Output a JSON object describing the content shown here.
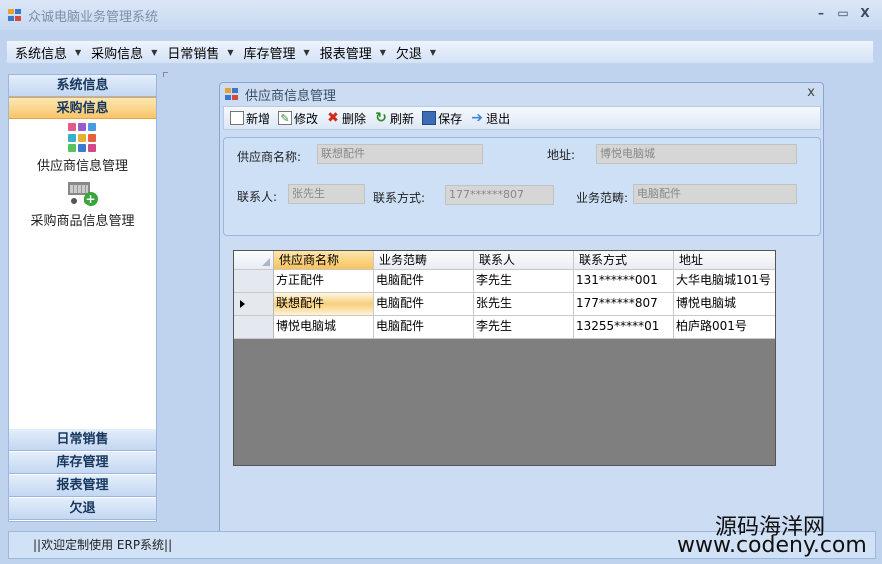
{
  "window": {
    "title": "众诚电脑业务管理系统",
    "min": "–",
    "max": "▭",
    "close": "X"
  },
  "menubar": {
    "items": [
      "系统信息",
      "采购信息",
      "日常销售",
      "库存管理",
      "报表管理",
      "欠退"
    ]
  },
  "leftnav": {
    "headers_top": [
      "系统信息",
      "采购信息"
    ],
    "entries": [
      "供应商信息管理",
      "采购商品信息管理"
    ],
    "headers_bottom": [
      "日常销售",
      "库存管理",
      "报表管理",
      "欠退"
    ]
  },
  "status": {
    "text": "||欢迎定制使用 ERP系统||"
  },
  "child": {
    "title": "供应商信息管理",
    "close": "x",
    "toolbar": [
      "新增",
      "修改",
      "删除",
      "刷新",
      "保存",
      "退出"
    ],
    "form": {
      "supplier_label": "供应商名称:",
      "supplier_value": "联想配件",
      "address_label": "地址:",
      "address_value": "博悦电脑城",
      "contact_label": "联系人:",
      "contact_value": "张先生",
      "phone_label": "联系方式:",
      "phone_value": "177******807",
      "scope_label": "业务范畴:",
      "scope_value": "电脑配件"
    },
    "grid": {
      "columns": [
        "供应商名称",
        "业务范畴",
        "联系人",
        "联系方式",
        "地址"
      ],
      "rows": [
        [
          "方正配件",
          "电脑配件",
          "李先生",
          "131******001",
          "大华电脑城101号"
        ],
        [
          "联想配件",
          "电脑配件",
          "张先生",
          "177******807",
          "博悦电脑城"
        ],
        [
          "博悦电脑城",
          "电脑配件",
          "李先生",
          "13255*****01",
          "柏庐路001号"
        ]
      ],
      "selected_row": 1
    }
  },
  "watermark": {
    "line1": "源码海洋网",
    "line2": "www.codeny.com"
  }
}
